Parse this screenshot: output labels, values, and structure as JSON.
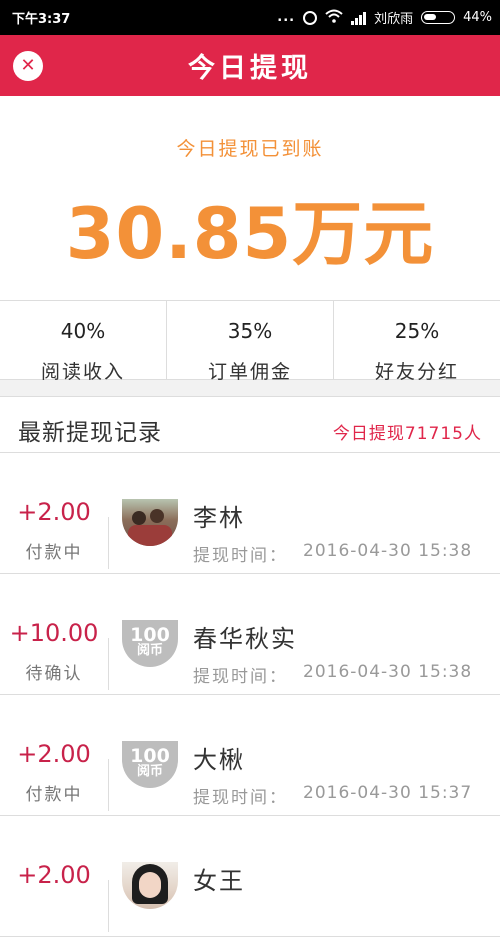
{
  "status_bar": {
    "time": "下午3:37",
    "carrier": "刘欣雨",
    "battery": "44%",
    "icons": [
      "more-dots-icon",
      "alarm-icon",
      "wifi-icon",
      "signal-icon",
      "battery-icon"
    ]
  },
  "header": {
    "title": "今日提现",
    "close_icon": "close-icon",
    "accent_color": "#e0264a"
  },
  "hero": {
    "subtitle": "今日提现已到账",
    "amount": "30.85万元",
    "color": "#f39138"
  },
  "stats": [
    {
      "percent": "40%",
      "label": "阅读收入"
    },
    {
      "percent": "35%",
      "label": "订单佣金"
    },
    {
      "percent": "25%",
      "label": "好友分红"
    }
  ],
  "list": {
    "title": "最新提现记录",
    "count_text": "今日提现71715人"
  },
  "records": [
    {
      "amount": "+2.00",
      "status": "付款中",
      "name": "李林",
      "time_label": "提现时间：",
      "time": "2016-04-30 15:38",
      "avatar": "photo-avatar"
    },
    {
      "amount": "+10.00",
      "status": "待确认",
      "name": "春华秋实",
      "time_label": "提现时间：",
      "time": "2016-04-30 15:38",
      "avatar": "logo-avatar",
      "logo_num": "100",
      "logo_sub": "阅币"
    },
    {
      "amount": "+2.00",
      "status": "付款中",
      "name": "大楸",
      "time_label": "提现时间：",
      "time": "2016-04-30 15:37",
      "avatar": "logo-avatar",
      "logo_num": "100",
      "logo_sub": "阅币"
    },
    {
      "amount": "+2.00",
      "status": "",
      "name": "女王",
      "time_label": "",
      "time": "",
      "avatar": "woman-avatar"
    }
  ]
}
